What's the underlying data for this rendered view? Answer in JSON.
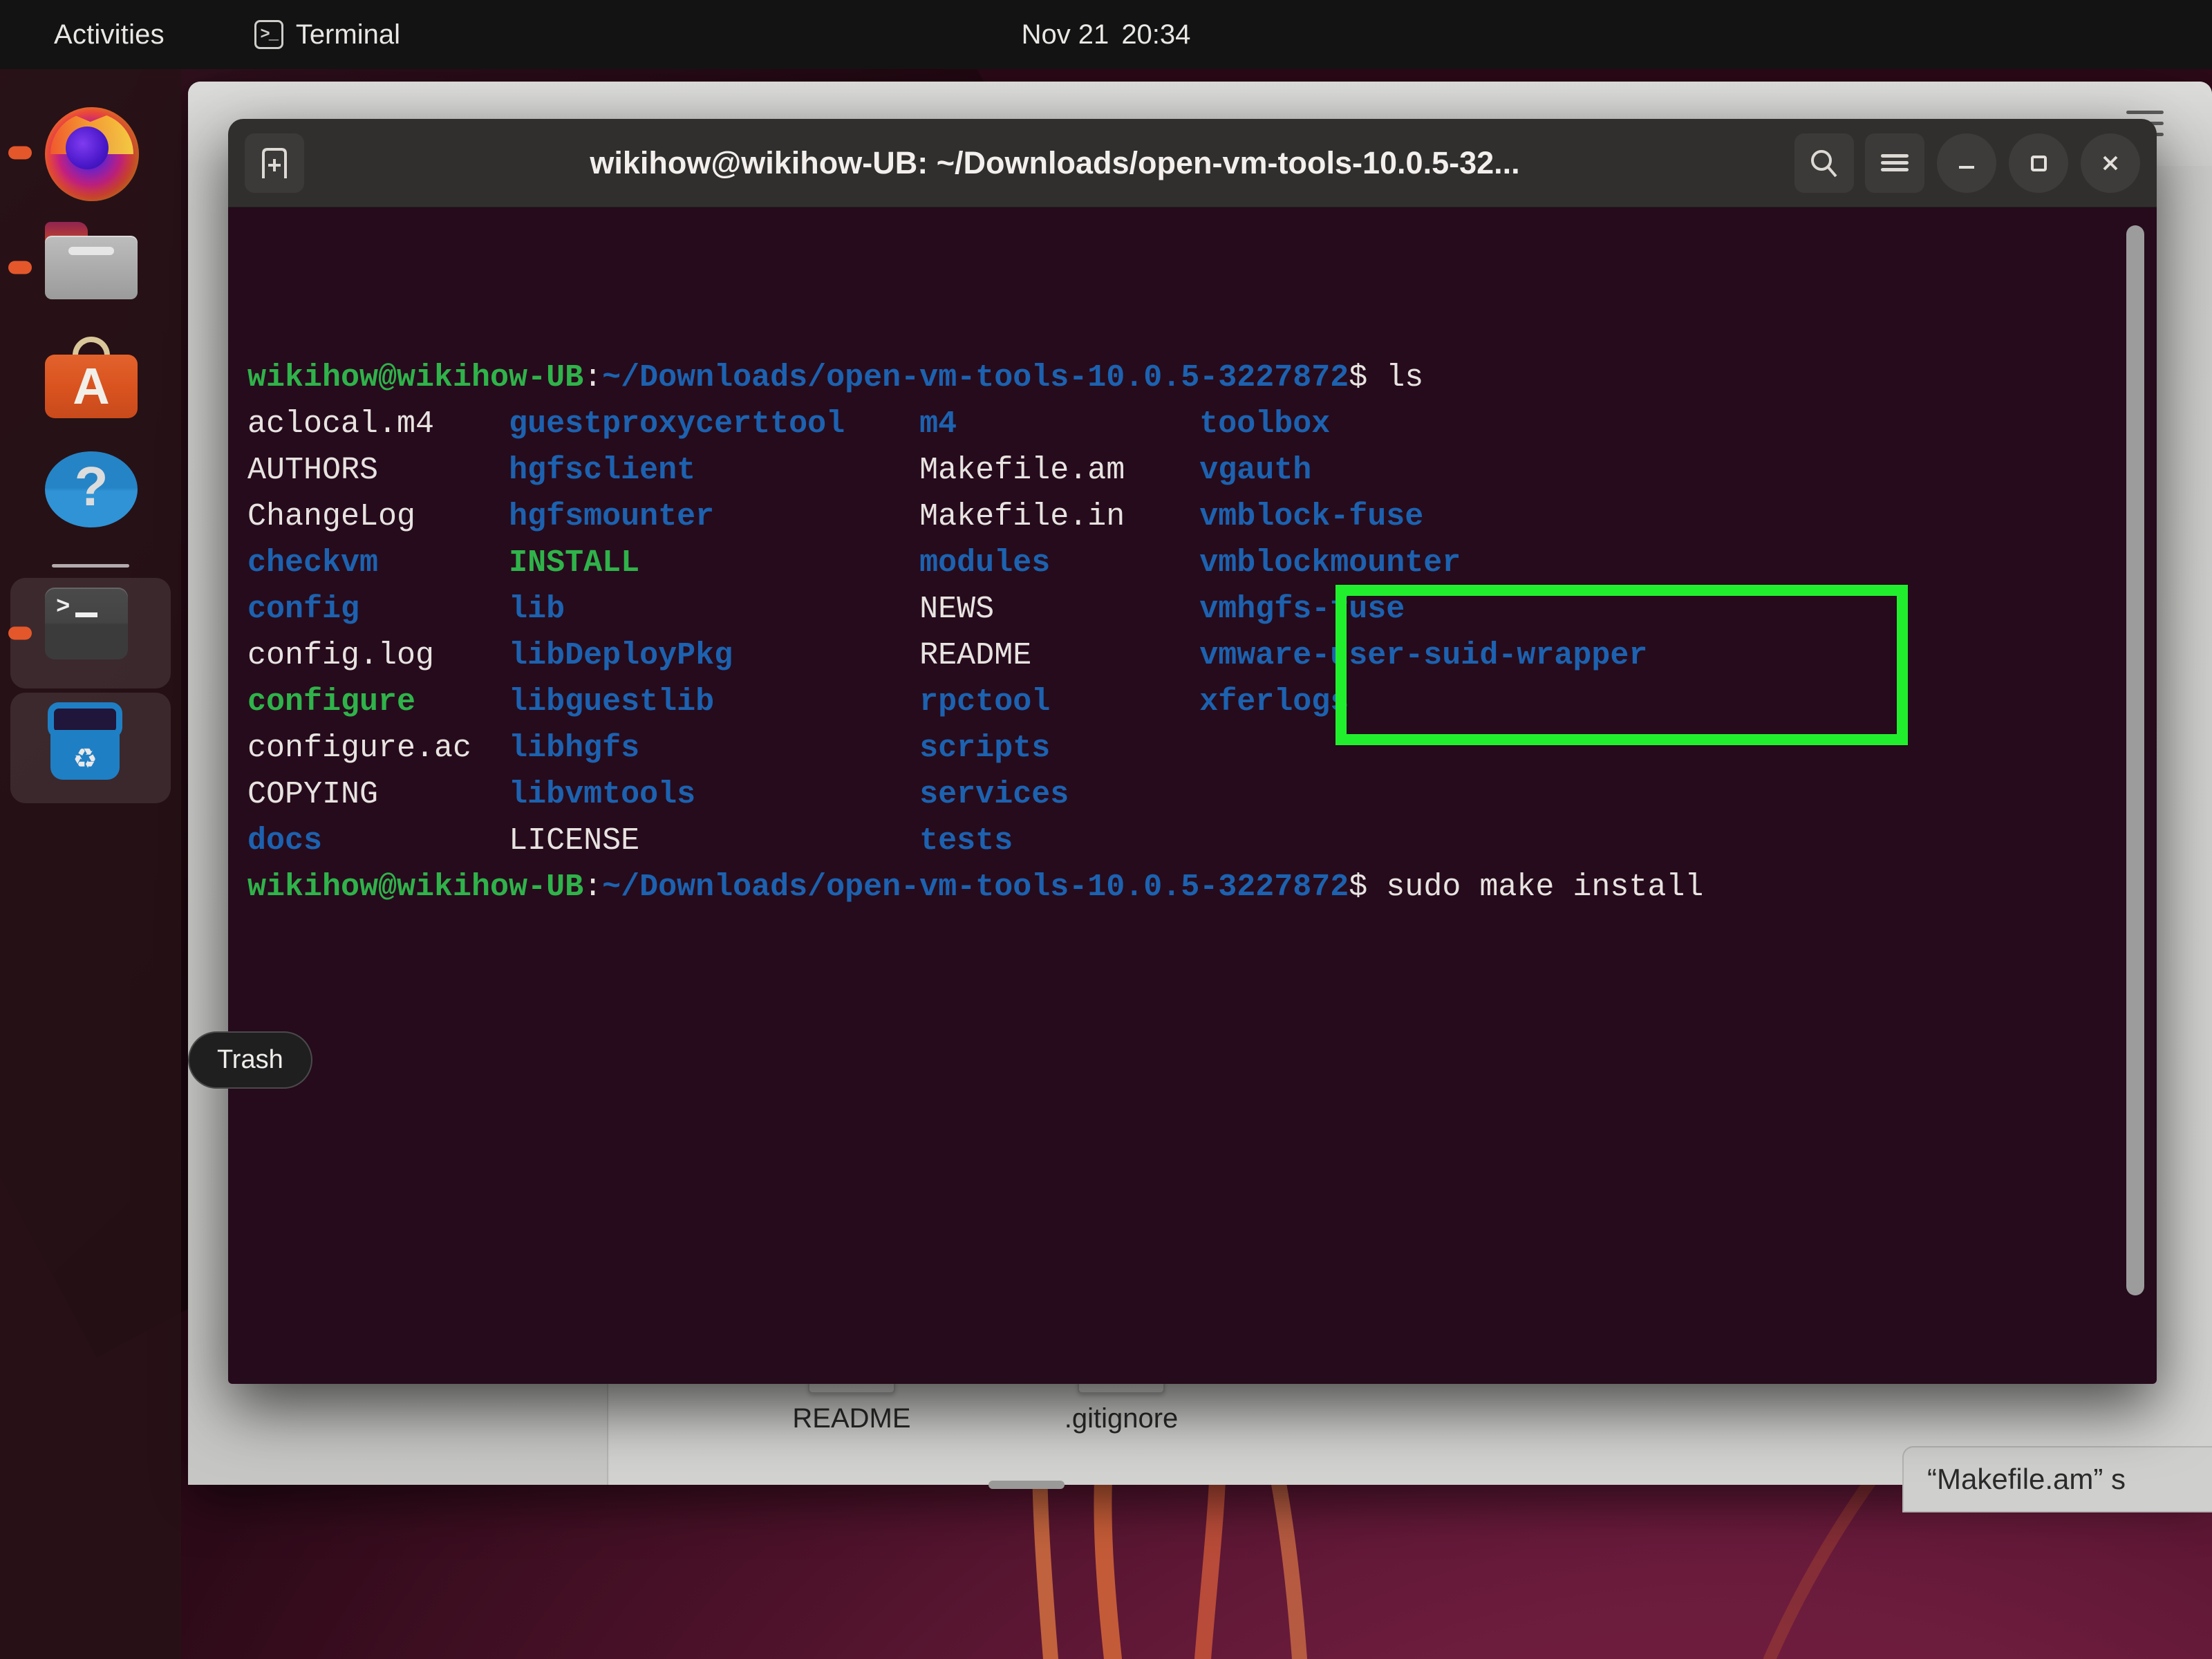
{
  "topbar": {
    "activities": "Activities",
    "app_icon": "terminal-icon",
    "app_name": "Terminal",
    "clock_date": "Nov 21",
    "clock_time": "20:34"
  },
  "dock": {
    "items": [
      {
        "name": "firefox",
        "label": "Firefox",
        "running": true
      },
      {
        "name": "files",
        "label": "Files",
        "running": true
      },
      {
        "name": "software",
        "label": "Ubuntu Software",
        "glyph": "A",
        "running": false
      },
      {
        "name": "help",
        "label": "Help",
        "glyph": "?",
        "running": false
      },
      {
        "name": "terminal",
        "label": "Terminal",
        "glyph": ">_",
        "running": true
      },
      {
        "name": "trash",
        "label": "Trash",
        "glyph": "♻",
        "running": false
      }
    ],
    "tooltip": "Trash"
  },
  "files_window": {
    "menu_icon": "hamburger-icon",
    "files": [
      {
        "label": "README"
      },
      {
        "label": ".gitignore"
      }
    ],
    "status": "“Makefile.am” s"
  },
  "terminal": {
    "title": "wikihow@wikihow-UB: ~/Downloads/open-vm-tools-10.0.5-32...",
    "new_tab_icon": "new-tab-icon",
    "search_icon": "search-icon",
    "menu_icon": "hamburger-icon",
    "minimize_icon": "minimize-icon",
    "maximize_icon": "maximize-icon",
    "close_icon": "close-icon",
    "background": "#260b1c",
    "prompt": {
      "user_host": "wikihow@wikihow-UB",
      "colon": ":",
      "path": "~/Downloads/open-vm-tools-10.0.5-3227872",
      "sigil": "$"
    },
    "first_command": "ls",
    "second_command": "sudo make install",
    "ls_rows": [
      [
        {
          "text": "aclocal.m4",
          "kind": "file"
        },
        {
          "text": "guestproxycerttool",
          "kind": "dir"
        },
        {
          "text": "m4",
          "kind": "dir"
        },
        {
          "text": "toolbox",
          "kind": "dir"
        }
      ],
      [
        {
          "text": "AUTHORS",
          "kind": "file"
        },
        {
          "text": "hgfsclient",
          "kind": "dir"
        },
        {
          "text": "Makefile.am",
          "kind": "file"
        },
        {
          "text": "vgauth",
          "kind": "dir"
        }
      ],
      [
        {
          "text": "ChangeLog",
          "kind": "file"
        },
        {
          "text": "hgfsmounter",
          "kind": "dir"
        },
        {
          "text": "Makefile.in",
          "kind": "file"
        },
        {
          "text": "vmblock-fuse",
          "kind": "dir"
        }
      ],
      [
        {
          "text": "checkvm",
          "kind": "dir"
        },
        {
          "text": "INSTALL",
          "kind": "exec"
        },
        {
          "text": "modules",
          "kind": "dir"
        },
        {
          "text": "vmblockmounter",
          "kind": "dir"
        }
      ],
      [
        {
          "text": "config",
          "kind": "dir"
        },
        {
          "text": "lib",
          "kind": "dir"
        },
        {
          "text": "NEWS",
          "kind": "file"
        },
        {
          "text": "vmhgfs-fuse",
          "kind": "dir"
        }
      ],
      [
        {
          "text": "config.log",
          "kind": "file"
        },
        {
          "text": "libDeployPkg",
          "kind": "dir"
        },
        {
          "text": "README",
          "kind": "file"
        },
        {
          "text": "vmware-user-suid-wrapper",
          "kind": "dir"
        }
      ],
      [
        {
          "text": "configure",
          "kind": "exec"
        },
        {
          "text": "libguestlib",
          "kind": "dir"
        },
        {
          "text": "rpctool",
          "kind": "dir"
        },
        {
          "text": "xferlogs",
          "kind": "dir"
        }
      ],
      [
        {
          "text": "configure.ac",
          "kind": "file"
        },
        {
          "text": "libhgfs",
          "kind": "dir"
        },
        {
          "text": "scripts",
          "kind": "dir"
        },
        {
          "text": "",
          "kind": "file"
        }
      ],
      [
        {
          "text": "COPYING",
          "kind": "file"
        },
        {
          "text": "libvmtools",
          "kind": "dir"
        },
        {
          "text": "services",
          "kind": "dir"
        },
        {
          "text": "",
          "kind": "file"
        }
      ],
      [
        {
          "text": "docs",
          "kind": "dir"
        },
        {
          "text": "LICENSE",
          "kind": "file"
        },
        {
          "text": "tests",
          "kind": "dir"
        },
        {
          "text": "",
          "kind": "file"
        }
      ]
    ],
    "highlight_color": "#21ef2e"
  }
}
